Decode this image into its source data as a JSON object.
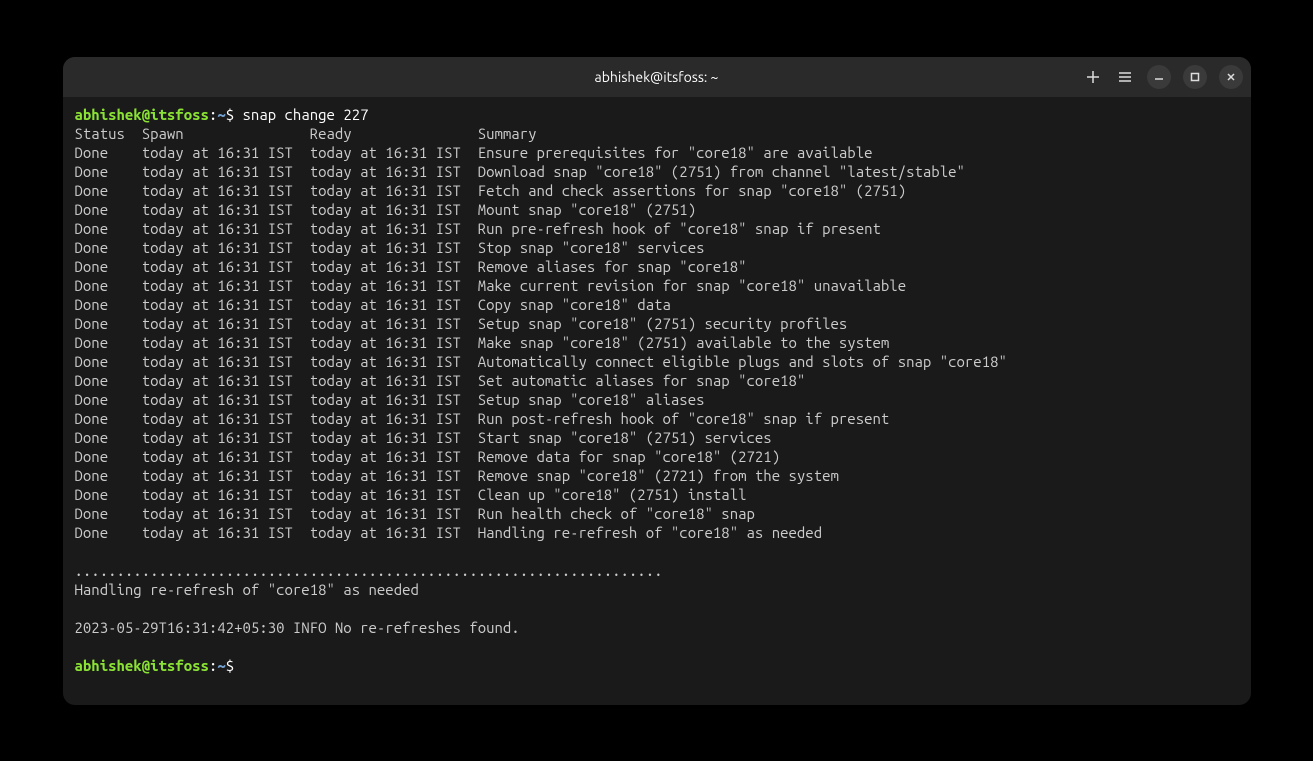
{
  "window": {
    "title": "abhishek@itsfoss: ~"
  },
  "prompt": {
    "user_host": "abhishek@itsfoss",
    "colon": ":",
    "path": "~",
    "dollar": "$"
  },
  "command": "snap change 227",
  "header": {
    "status": "Status",
    "spawn": "Spawn",
    "ready": "Ready",
    "summary": "Summary"
  },
  "rows": [
    {
      "status": "Done",
      "spawn": "today at 16:31 IST",
      "ready": "today at 16:31 IST",
      "summary": "Ensure prerequisites for \"core18\" are available"
    },
    {
      "status": "Done",
      "spawn": "today at 16:31 IST",
      "ready": "today at 16:31 IST",
      "summary": "Download snap \"core18\" (2751) from channel \"latest/stable\""
    },
    {
      "status": "Done",
      "spawn": "today at 16:31 IST",
      "ready": "today at 16:31 IST",
      "summary": "Fetch and check assertions for snap \"core18\" (2751)"
    },
    {
      "status": "Done",
      "spawn": "today at 16:31 IST",
      "ready": "today at 16:31 IST",
      "summary": "Mount snap \"core18\" (2751)"
    },
    {
      "status": "Done",
      "spawn": "today at 16:31 IST",
      "ready": "today at 16:31 IST",
      "summary": "Run pre-refresh hook of \"core18\" snap if present"
    },
    {
      "status": "Done",
      "spawn": "today at 16:31 IST",
      "ready": "today at 16:31 IST",
      "summary": "Stop snap \"core18\" services"
    },
    {
      "status": "Done",
      "spawn": "today at 16:31 IST",
      "ready": "today at 16:31 IST",
      "summary": "Remove aliases for snap \"core18\""
    },
    {
      "status": "Done",
      "spawn": "today at 16:31 IST",
      "ready": "today at 16:31 IST",
      "summary": "Make current revision for snap \"core18\" unavailable"
    },
    {
      "status": "Done",
      "spawn": "today at 16:31 IST",
      "ready": "today at 16:31 IST",
      "summary": "Copy snap \"core18\" data"
    },
    {
      "status": "Done",
      "spawn": "today at 16:31 IST",
      "ready": "today at 16:31 IST",
      "summary": "Setup snap \"core18\" (2751) security profiles"
    },
    {
      "status": "Done",
      "spawn": "today at 16:31 IST",
      "ready": "today at 16:31 IST",
      "summary": "Make snap \"core18\" (2751) available to the system"
    },
    {
      "status": "Done",
      "spawn": "today at 16:31 IST",
      "ready": "today at 16:31 IST",
      "summary": "Automatically connect eligible plugs and slots of snap \"core18\""
    },
    {
      "status": "Done",
      "spawn": "today at 16:31 IST",
      "ready": "today at 16:31 IST",
      "summary": "Set automatic aliases for snap \"core18\""
    },
    {
      "status": "Done",
      "spawn": "today at 16:31 IST",
      "ready": "today at 16:31 IST",
      "summary": "Setup snap \"core18\" aliases"
    },
    {
      "status": "Done",
      "spawn": "today at 16:31 IST",
      "ready": "today at 16:31 IST",
      "summary": "Run post-refresh hook of \"core18\" snap if present"
    },
    {
      "status": "Done",
      "spawn": "today at 16:31 IST",
      "ready": "today at 16:31 IST",
      "summary": "Start snap \"core18\" (2751) services"
    },
    {
      "status": "Done",
      "spawn": "today at 16:31 IST",
      "ready": "today at 16:31 IST",
      "summary": "Remove data for snap \"core18\" (2721)"
    },
    {
      "status": "Done",
      "spawn": "today at 16:31 IST",
      "ready": "today at 16:31 IST",
      "summary": "Remove snap \"core18\" (2721) from the system"
    },
    {
      "status": "Done",
      "spawn": "today at 16:31 IST",
      "ready": "today at 16:31 IST",
      "summary": "Clean up \"core18\" (2751) install"
    },
    {
      "status": "Done",
      "spawn": "today at 16:31 IST",
      "ready": "today at 16:31 IST",
      "summary": "Run health check of \"core18\" snap"
    },
    {
      "status": "Done",
      "spawn": "today at 16:31 IST",
      "ready": "today at 16:31 IST",
      "summary": "Handling re-refresh of \"core18\" as needed"
    }
  ],
  "trailer": {
    "dots": "......................................................................",
    "handling": "Handling re-refresh of \"core18\" as needed",
    "info": "2023-05-29T16:31:42+05:30 INFO No re-refreshes found."
  }
}
